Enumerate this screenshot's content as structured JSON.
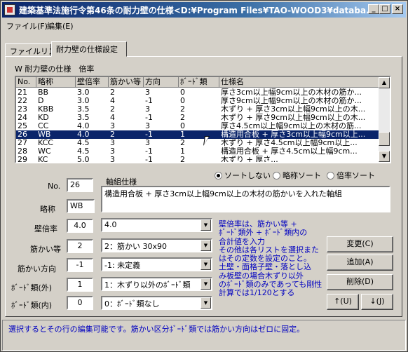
{
  "window": {
    "title": "建築基準法施行令第46条の耐力壁の仕様<D:¥Program Files¥TAO-WOOD3¥databa...",
    "min_label": "_",
    "max_label": "□",
    "close_label": "×"
  },
  "menu": [
    "ファイル(F)",
    "編集(E)"
  ],
  "tabs": [
    "ファイルリスト",
    "耐力壁の仕様設定"
  ],
  "grid": {
    "label": "W 耐力壁の仕様　倍率",
    "headers": [
      "No.",
      "略称",
      "壁倍率",
      "筋かい等",
      "方向",
      "ﾎﾞｰﾄﾞ類",
      "仕様名"
    ],
    "rows": [
      [
        "21",
        "BB",
        "3.0",
        "2",
        "3",
        "0",
        "厚さ3cm以上幅9cm以上の木材の筋か..."
      ],
      [
        "22",
        "D",
        "3.0",
        "4",
        "-1",
        "0",
        "厚さ9cm以上幅9cm以上の木材の筋か..."
      ],
      [
        "23",
        "KBB",
        "3.5",
        "2",
        "3",
        "2",
        "木ずり + 厚さ3cm以上幅9cm以上の木..."
      ],
      [
        "24",
        "KD",
        "3.5",
        "4",
        "-1",
        "2",
        "木ずり + 厚さ9cm以上幅9cm以上の木..."
      ],
      [
        "25",
        "CC",
        "4.0",
        "3",
        "3",
        "0",
        "厚さ4.5cm以上幅9cm以上の木材の筋..."
      ],
      [
        "26",
        "WB",
        "4.0",
        "2",
        "-1",
        "1",
        "構造用合板 + 厚さ3cm以上幅9cm以上..."
      ],
      [
        "27",
        "KCC",
        "4.5",
        "3",
        "3",
        "2",
        "木ずり + 厚さ4.5cm以上幅9cm以上..."
      ],
      [
        "28",
        "WC",
        "4.5",
        "3",
        "-1",
        "1",
        "構造用合板 + 厚さ4.5cm以上幅9cm..."
      ],
      [
        "29",
        "KC",
        "5.0",
        "3",
        "-1",
        "2",
        "木ずり + 厚さ..."
      ]
    ],
    "selected_index": 5
  },
  "sort": {
    "options": [
      "ソートしない",
      "略称ソート",
      "倍率ソート"
    ],
    "selected": 0
  },
  "form": {
    "no_label": "No.",
    "no_value": "26",
    "abbr_label": "略称",
    "abbr_value": "WB",
    "spec_label": "軸組仕様",
    "spec_value": "構造用合板 + 厚さ3cm以上幅9cm以上の木材の筋かいを入れた軸組",
    "rate_label": "壁倍率",
    "rate_value": "4.0",
    "rate_combo": "4.0",
    "brace_label": "筋かい等",
    "brace_value": "2",
    "brace_combo": "2：筋かい 30x90",
    "dir_label": "筋かい方向",
    "dir_value": "-1",
    "dir_combo": "-1: 未定義",
    "board_out_label": "ﾎﾞｰﾄﾞ類(外)",
    "board_out_value": "1",
    "board_out_combo": "1：木ずり以外のﾎﾞｰﾄﾞ類",
    "board_in_label": "ﾎﾞｰﾄﾞ類(内)",
    "board_in_value": "0",
    "board_in_combo": "0：ﾎﾞｰﾄﾞ類なし"
  },
  "note_lines": [
    "壁倍率は、筋かい等 +",
    "ﾎﾞｰﾄﾞ類外 + ﾎﾞｰﾄﾞ類内の",
    "合計値を入力",
    "その他は各リストを選択また",
    "はその定数を設定のこと。",
    "土壁・面格子壁・落とし込",
    "み板壁の場合木ずり以外",
    "のﾎﾞｰﾄﾞ類のみであっても剛性",
    "計算では1/120とする"
  ],
  "buttons": {
    "change": "変更(C)",
    "add": "追加(A)",
    "delete": "削除(D)",
    "up": "↑(U)",
    "down": "↓(J)"
  },
  "status": "選択するとその行の編集可能です。筋かい区分ﾎﾞｰﾄﾞ類では筋かい方向はゼロに固定。"
}
